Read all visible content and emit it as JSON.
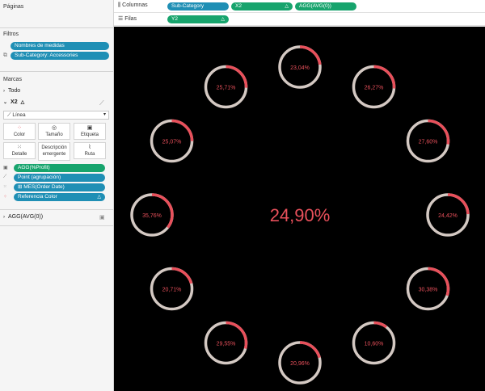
{
  "left_panel": {
    "pages_title": "Páginas",
    "filters_title": "Filtros",
    "filters": [
      "Nombres de medidas",
      "Sub-Category: Accessories"
    ],
    "marks_title": "Marcas",
    "all_label": "Todo",
    "x2_label": "X2",
    "mark_type": "Línea",
    "buttons": [
      "Color",
      "Tamaño",
      "Etiqueta",
      "Detalle",
      "Descripción emergente",
      "Ruta"
    ],
    "fields": [
      "AGG(%Profit)",
      "Point (agrupación)",
      "MES(Order Date)",
      "Referencia Color"
    ],
    "agg_card": "AGG(AVG(0))"
  },
  "shelves": {
    "columns_label": "Columnas",
    "rows_label": "Filas",
    "columns_pills": [
      "Sub-Category",
      "X2",
      "AGG(AVG(0))"
    ],
    "rows_pills": [
      "Y2"
    ]
  },
  "colors": {
    "accent_red": "#e8505b",
    "ring_track": "#d4c9c3",
    "label_red": "#e8505b",
    "pill_blue": "#1f8fb5",
    "pill_green": "#17a46d"
  },
  "chart_data": {
    "type": "donut-ring-grid",
    "center_value": "24,90%",
    "rings": [
      {
        "label": "23,04%",
        "value": 0.2304
      },
      {
        "label": "26,27%",
        "value": 0.2627
      },
      {
        "label": "27,60%",
        "value": 0.276
      },
      {
        "label": "24,42%",
        "value": 0.2442
      },
      {
        "label": "30,38%",
        "value": 0.3038
      },
      {
        "label": "10,60%",
        "value": 0.106
      },
      {
        "label": "20,96%",
        "value": 0.2096
      },
      {
        "label": "29,55%",
        "value": 0.2955
      },
      {
        "label": "20,71%",
        "value": 0.2071
      },
      {
        "label": "35,76%",
        "value": 0.3576
      },
      {
        "label": "25,07%",
        "value": 0.2507
      },
      {
        "label": "25,71%",
        "value": 0.2571
      }
    ]
  }
}
